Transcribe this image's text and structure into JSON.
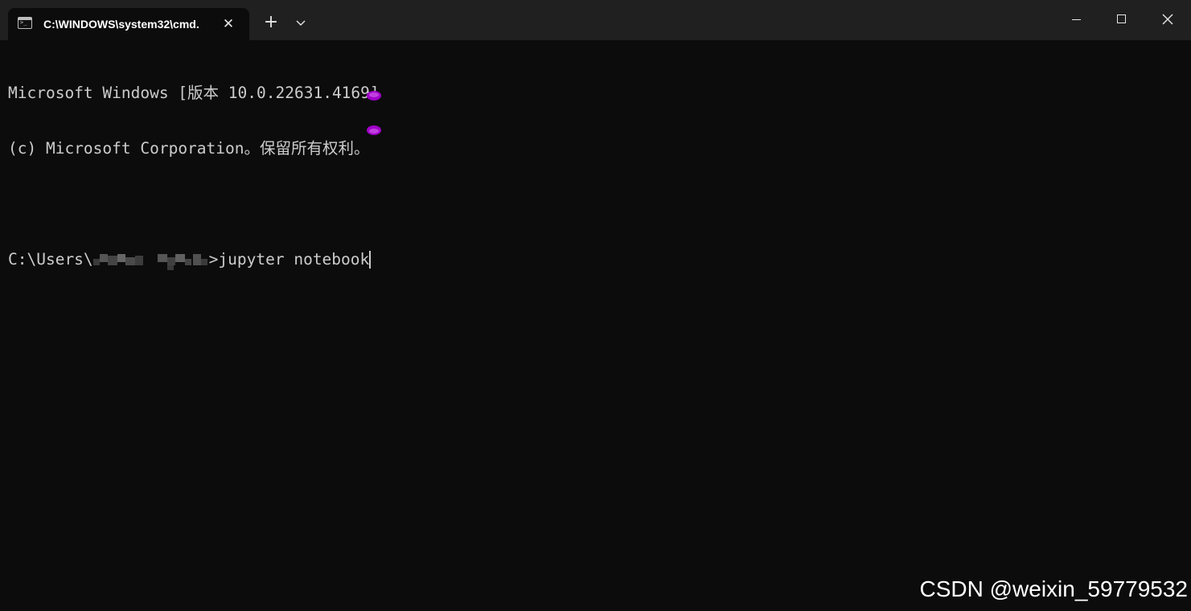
{
  "window": {
    "tab_title": "C:\\WINDOWS\\system32\\cmd.",
    "tab_icon": "terminal-icon",
    "tab_close_glyph": "✕",
    "new_tab_glyph": "+",
    "controls": [
      "minimize-icon",
      "maximize-icon",
      "close-icon"
    ]
  },
  "terminal": {
    "line1": "Microsoft Windows [版本 10.0.22631.4169]",
    "line2": "(c) Microsoft Corporation。保留所有权利。",
    "prompt_prefix": "C:\\Users\\",
    "prompt_suffix": ">",
    "command": "jupyter notebook"
  },
  "colors": {
    "terminal_bg": "#0c0c0c",
    "titlebar_bg": "#202020",
    "text": "#cccccc",
    "caret_handle": "#a000c8"
  },
  "watermark": "CSDN @weixin_59779532"
}
